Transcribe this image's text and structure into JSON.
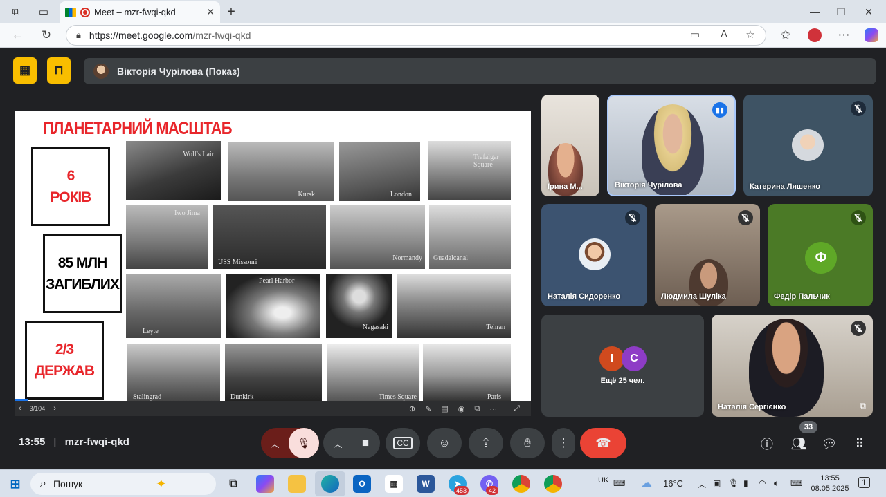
{
  "browser": {
    "tab_title": "Meet – mzr-fwqi-qkd",
    "tab_close": "✕",
    "new_tab": "+",
    "url_host": "https://meet.google.com",
    "url_path": "/mzr-fwqi-qkd"
  },
  "meet": {
    "presenter_label": "Вікторія Чурілова (Показ)",
    "time": "13:55",
    "separator": "|",
    "meeting_code": "mzr-fwqi-qkd",
    "participant_count": "33",
    "others_label": "Ещё 25 чел.",
    "others_avatars": [
      {
        "letter": "I",
        "color": "#d04a1e"
      },
      {
        "letter": "C",
        "color": "#8e3cc6"
      }
    ]
  },
  "slide": {
    "title": "ПЛАНЕТАРНИЙ МАСШТАБ",
    "stats": [
      {
        "line1": "6",
        "line2": "РОКІВ"
      },
      {
        "line1": "85 МЛН",
        "line2": "ЗАГИБЛИХ"
      },
      {
        "line1": "2/3",
        "line2": "ДЕРЖАВ"
      }
    ],
    "captions": [
      "Wolf's Lair",
      "Kursk",
      "London",
      "Trafalgar Square",
      "Iwo Jima",
      "USS Missouri",
      "Normandy",
      "Guadalcanal",
      "Pearl Harbor",
      "Leyte",
      "Nagasaki",
      "Tehran",
      "Stalingrad",
      "Dunkirk",
      "Times Square",
      "Paris"
    ],
    "page": "3/104"
  },
  "participants": [
    {
      "name": "Ірина М..."
    },
    {
      "name": "Вікторія Чурілова"
    },
    {
      "name": "Катерина Ляшенко"
    },
    {
      "name": "Наталія Сидоренко"
    },
    {
      "name": "Людмила Шуліка"
    },
    {
      "name": "Федір Пальчик",
      "initial": "Ф"
    },
    {
      "name": "Наталія Сергієнко"
    }
  ],
  "taskbar": {
    "search": "Пошук",
    "telegram_badge": "453",
    "viber_badge": "42",
    "lang": "UK",
    "weather": "16°C",
    "clock_time": "13:55",
    "clock_date": "08.05.2025",
    "notif": "1"
  },
  "colors": {
    "accent_yellow": "#f9be00",
    "end_call": "#ea4335",
    "mic_off": "#f9dedc",
    "slide_red": "#e8262b"
  }
}
